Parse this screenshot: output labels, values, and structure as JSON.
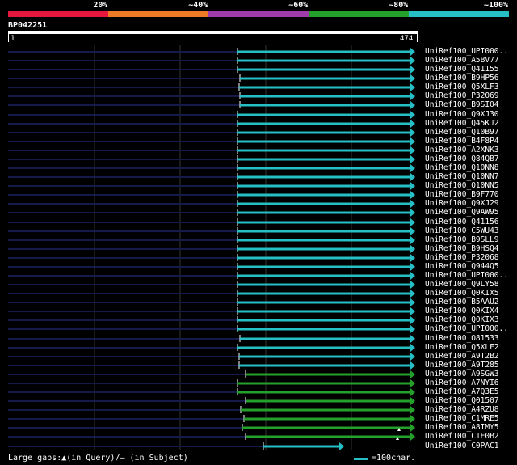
{
  "legend": {
    "labels": [
      "20%",
      "~40%",
      "~60%",
      "~80%",
      "~100%"
    ],
    "colors": [
      "#e6173d",
      "#ef7a26",
      "#9f3cab",
      "#24a12a",
      "#26bfc6"
    ]
  },
  "query": {
    "id": "BP042251",
    "start_label": "1",
    "end_label": "474"
  },
  "colors": {
    "background": "#000000",
    "faint_line": "#141a4a",
    "grid": "#333333"
  },
  "hits": [
    {
      "name": "UniRef100_UPI000..",
      "color": "cyan"
    },
    {
      "name": "UniRef100_A5BV77",
      "color": "cyan"
    },
    {
      "name": "UniRef100_Q41155",
      "color": "cyan"
    },
    {
      "name": "UniRef100_B9HP56",
      "color": "cyan"
    },
    {
      "name": "UniRef100_Q5XLF3",
      "color": "cyan"
    },
    {
      "name": "UniRef100_P32069",
      "color": "cyan"
    },
    {
      "name": "UniRef100_B9SI04",
      "color": "cyan"
    },
    {
      "name": "UniRef100_Q9XJ30",
      "color": "cyan"
    },
    {
      "name": "UniRef100_Q45KJ2",
      "color": "cyan"
    },
    {
      "name": "UniRef100_Q10B97",
      "color": "cyan"
    },
    {
      "name": "UniRef100_B4F8P4",
      "color": "cyan"
    },
    {
      "name": "UniRef100_A2XNK3",
      "color": "cyan"
    },
    {
      "name": "UniRef100_Q84QB7",
      "color": "cyan"
    },
    {
      "name": "UniRef100_Q10NN8",
      "color": "cyan"
    },
    {
      "name": "UniRef100_Q10NN7",
      "color": "cyan"
    },
    {
      "name": "UniRef100_Q10NN5",
      "color": "cyan"
    },
    {
      "name": "UniRef100_B9F770",
      "color": "cyan"
    },
    {
      "name": "UniRef100_Q9XJ29",
      "color": "cyan"
    },
    {
      "name": "UniRef100_Q9AW95",
      "color": "cyan"
    },
    {
      "name": "UniRef100_Q41156",
      "color": "cyan"
    },
    {
      "name": "UniRef100_C5WU43",
      "color": "cyan"
    },
    {
      "name": "UniRef100_B9SLL9",
      "color": "cyan"
    },
    {
      "name": "UniRef100_B9HSQ4",
      "color": "cyan"
    },
    {
      "name": "UniRef100_P32068",
      "color": "cyan"
    },
    {
      "name": "UniRef100_Q944Q5",
      "color": "cyan"
    },
    {
      "name": "UniRef100_UPI000..",
      "color": "cyan"
    },
    {
      "name": "UniRef100_Q9LY58",
      "color": "cyan"
    },
    {
      "name": "UniRef100_Q0KIX5",
      "color": "cyan"
    },
    {
      "name": "UniRef100_B5AAU2",
      "color": "cyan"
    },
    {
      "name": "UniRef100_Q0KIX4",
      "color": "cyan"
    },
    {
      "name": "UniRef100_Q0KIX3",
      "color": "cyan"
    },
    {
      "name": "UniRef100_UPI000..",
      "color": "cyan"
    },
    {
      "name": "UniRef100_O81533",
      "color": "cyan"
    },
    {
      "name": "UniRef100_Q5XLF2",
      "color": "cyan"
    },
    {
      "name": "UniRef100_A9T2B2",
      "color": "cyan"
    },
    {
      "name": "UniRef100_A9T285",
      "color": "cyan"
    },
    {
      "name": "UniRef100_A9SGW3",
      "color": "green"
    },
    {
      "name": "UniRef100_A7NYI6",
      "color": "green"
    },
    {
      "name": "UniRef100_A7Q3E5",
      "color": "green"
    },
    {
      "name": "UniRef100_Q01507",
      "color": "green"
    },
    {
      "name": "UniRef100_A4RZU8",
      "color": "green"
    },
    {
      "name": "UniRef100_C1MRE5",
      "color": "green"
    },
    {
      "name": "UniRef100_A8IMY5",
      "color": "green"
    },
    {
      "name": "UniRef100_C1E0B2",
      "color": "green"
    },
    {
      "name": "UniRef100_C0PAC1",
      "color": "cyan"
    }
  ],
  "footer": {
    "gaps_text": "Large gaps:▲(in Query)/— (in Subject)",
    "scale_text": "=100char."
  }
}
